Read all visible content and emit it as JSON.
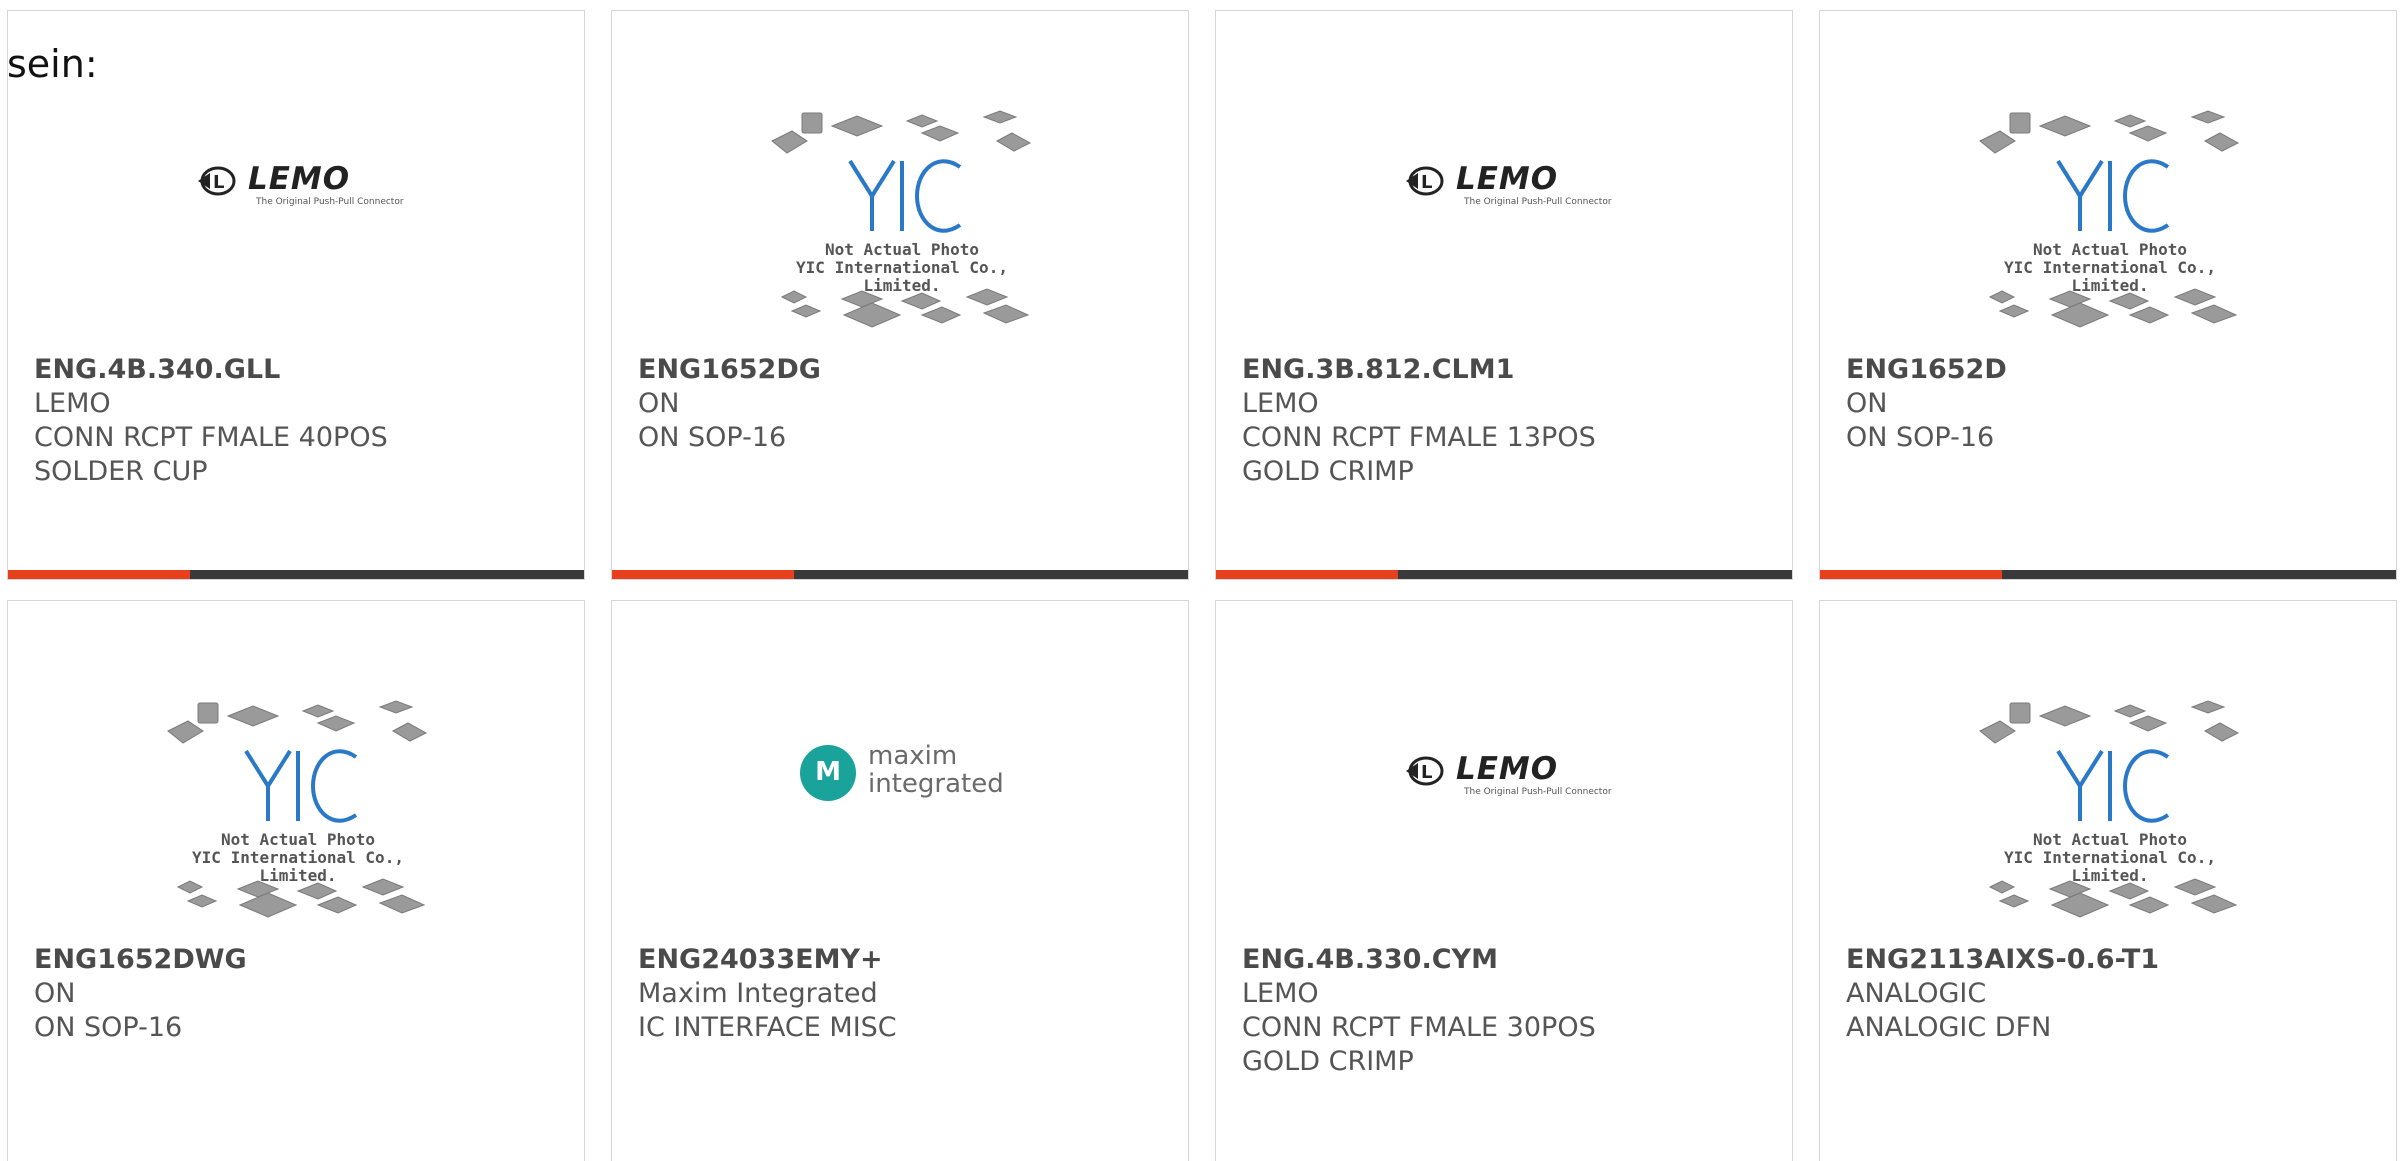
{
  "header_fragment": "sein:",
  "accent_colors": {
    "bar_accent": "#e8401c",
    "bar_base": "#3a3a3a",
    "yic_blue": "#2a78c8",
    "maxim_teal": "#1aa39a"
  },
  "logos": {
    "lemo": {
      "icon": "lemo-logo",
      "word": "LEMO",
      "tagline": "The Original Push-Pull Connector"
    },
    "maxim": {
      "icon": "maxim-logo",
      "badge": "M",
      "line1": "maxim",
      "line2": "integrated"
    },
    "yic": {
      "icon": "yic-placeholder",
      "caption_line1": "Not Actual Photo",
      "caption_line2": "YIC International Co., Limited."
    }
  },
  "products": [
    {
      "part_number": "ENG.4B.340.GLL",
      "manufacturer": "LEMO",
      "description": "CONN RCPT FMALE 40POS SOLDER CUP",
      "image": "lemo"
    },
    {
      "part_number": "ENG1652DG",
      "manufacturer": "ON",
      "description": "ON SOP-16",
      "image": "yic"
    },
    {
      "part_number": "ENG.3B.812.CLM1",
      "manufacturer": "LEMO",
      "description": "CONN RCPT FMALE 13POS GOLD CRIMP",
      "image": "lemo"
    },
    {
      "part_number": "ENG1652D",
      "manufacturer": "ON",
      "description": "ON SOP-16",
      "image": "yic"
    },
    {
      "part_number": "ENG1652DWG",
      "manufacturer": "ON",
      "description": "ON SOP-16",
      "image": "yic"
    },
    {
      "part_number": "ENG24033EMY+",
      "manufacturer": "Maxim Integrated",
      "description": "IC INTERFACE MISC",
      "image": "maxim"
    },
    {
      "part_number": "ENG.4B.330.CYM",
      "manufacturer": "LEMO",
      "description": "CONN RCPT FMALE 30POS GOLD CRIMP",
      "image": "lemo"
    },
    {
      "part_number": "ENG2113AIXS-0.6-T1",
      "manufacturer": "ANALOGIC",
      "description": "ANALOGIC DFN",
      "image": "yic"
    }
  ]
}
